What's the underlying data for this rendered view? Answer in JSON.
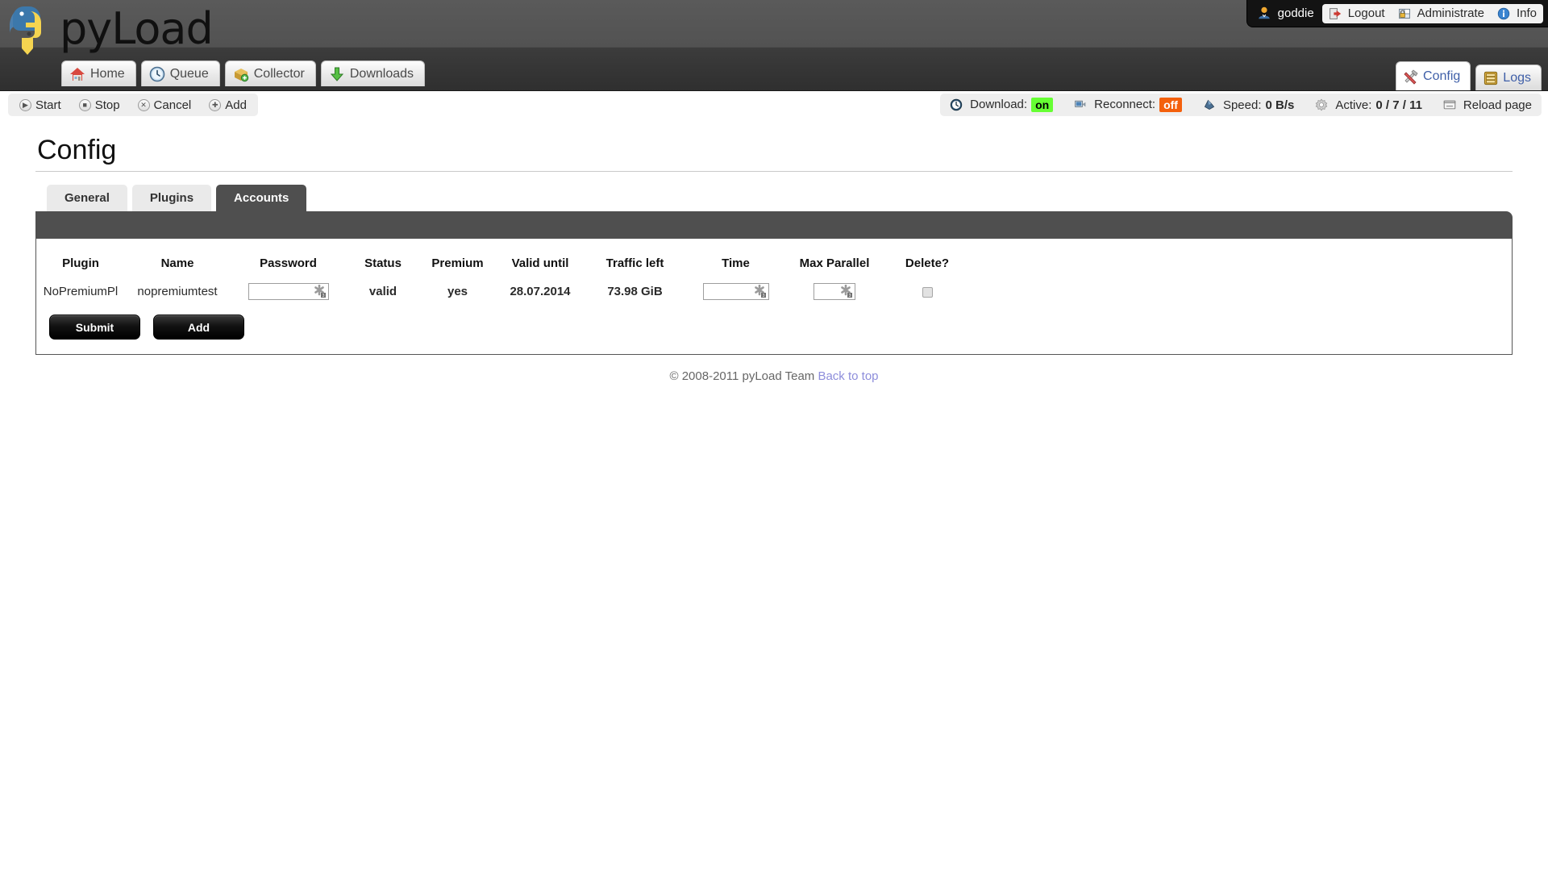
{
  "brand": {
    "name": "pyLoad",
    "logo_icon": "python-logo-icon"
  },
  "user": {
    "icon": "user-avatar-icon",
    "name": "goddie",
    "links": [
      {
        "label": "Logout",
        "icon": "logout-icon"
      },
      {
        "label": "Administrate",
        "icon": "admin-lock-icon"
      },
      {
        "label": "Info",
        "icon": "info-icon"
      }
    ]
  },
  "nav": {
    "items": [
      {
        "label": "Home",
        "icon": "home-icon"
      },
      {
        "label": "Queue",
        "icon": "clock-icon"
      },
      {
        "label": "Collector",
        "icon": "package-add-icon"
      },
      {
        "label": "Downloads",
        "icon": "download-arrow-icon"
      }
    ],
    "right_tabs": [
      {
        "label": "Config",
        "icon": "tools-icon",
        "active": true
      },
      {
        "label": "Logs",
        "icon": "drawer-icon",
        "active": false
      }
    ]
  },
  "toolbar": {
    "actions": [
      {
        "label": "Start",
        "icon": "play-icon",
        "glyph": "▶"
      },
      {
        "label": "Stop",
        "icon": "stop-icon",
        "glyph": "■"
      },
      {
        "label": "Cancel",
        "icon": "cancel-icon",
        "glyph": "✕"
      },
      {
        "label": "Add",
        "icon": "add-icon",
        "glyph": "✚"
      }
    ],
    "status": {
      "download_label": "Download:",
      "download_value": "on",
      "download_color": "#66ff33",
      "reconnect_label": "Reconnect:",
      "reconnect_value": "off",
      "reconnect_color": "#f4600c",
      "speed_label": "Speed:",
      "speed_value": "0 B/s",
      "active_label": "Active:",
      "active_value": "0 / 7 / 11",
      "reload_label": "Reload page",
      "icons": {
        "download": "clock-icon",
        "reconnect": "plug-icon",
        "speed": "speed-gauge-icon",
        "active": "gear-icon",
        "reload": "reload-window-icon"
      }
    }
  },
  "page": {
    "title": "Config",
    "tabs": [
      {
        "label": "General",
        "active": false
      },
      {
        "label": "Plugins",
        "active": false
      },
      {
        "label": "Accounts",
        "active": true
      }
    ]
  },
  "accounts_table": {
    "columns": [
      "Plugin",
      "Name",
      "Password",
      "Status",
      "Premium",
      "Valid until",
      "Traffic left",
      "Time",
      "Max Parallel",
      "Delete?"
    ],
    "rows": [
      {
        "plugin": "NoPremiumPl",
        "name": "nopremiumtest",
        "password": "",
        "password_placeholder": "",
        "status": "valid",
        "premium": "yes",
        "valid_until": "28.07.2014",
        "traffic_left": "73.98 GiB",
        "time": "",
        "max_parallel": "",
        "delete_checked": false
      }
    ]
  },
  "buttons": {
    "submit": "Submit",
    "add": "Add"
  },
  "footer": {
    "copyright": "© 2008-2011 pyLoad Team",
    "back_to_top": "Back to top"
  }
}
